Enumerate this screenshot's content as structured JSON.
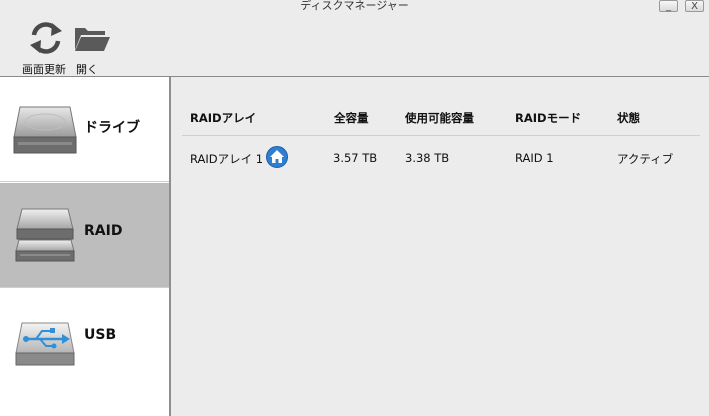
{
  "window": {
    "title": "ディスクマネージャー",
    "minimize_glyph": "_",
    "close_glyph": "X"
  },
  "toolbar": {
    "refresh_label": "画面更新",
    "open_label": "開く",
    "refresh_icon": "refresh-icon",
    "open_icon": "folder-icon"
  },
  "sidebar": {
    "items": [
      {
        "label": "ドライブ",
        "icon": "hard-drive-icon",
        "selected": false
      },
      {
        "label": "RAID",
        "icon": "raid-drive-icon",
        "selected": true
      },
      {
        "label": "USB",
        "icon": "usb-drive-icon",
        "selected": false
      }
    ]
  },
  "table": {
    "columns": [
      "RAIDアレイ",
      "全容量",
      "使用可能容量",
      "RAIDモード",
      "状態"
    ],
    "rows": [
      {
        "name": "RAIDアレイ 1",
        "total": "3.57 TB",
        "available": "3.38 TB",
        "mode": "RAID 1",
        "status": "アクティブ",
        "badge_icon": "home-icon"
      }
    ]
  },
  "colors": {
    "sidebar_selected": "#bdbdbd",
    "background": "#ececec",
    "home_badge": "#2f7fd0"
  }
}
